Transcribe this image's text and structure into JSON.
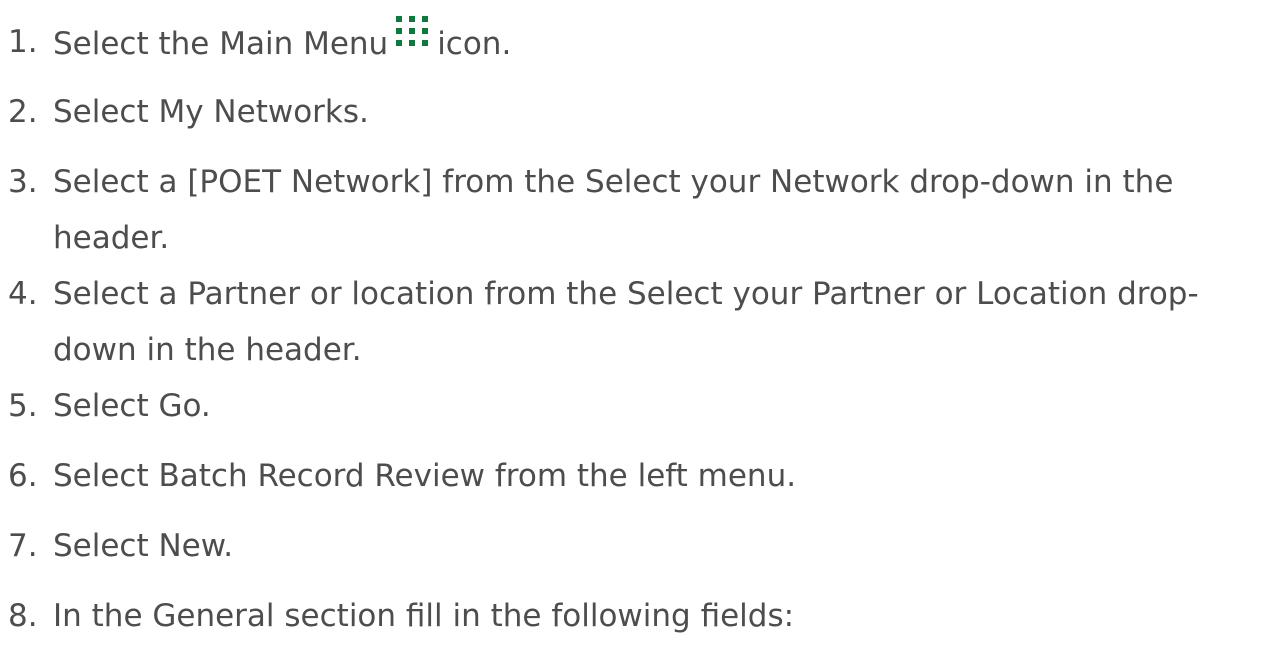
{
  "steps": [
    {
      "num": "1.",
      "before": "Select the Main Menu",
      "icon": "grid-menu-icon",
      "after": "icon."
    },
    {
      "num": "2.",
      "text": "Select My Networks."
    },
    {
      "num": "3.",
      "line1": "Select a [POET Network] from the Select your Network drop-down in the",
      "line2": "header."
    },
    {
      "num": "4.",
      "line1": "Select a Partner or location from the Select your Partner or Location drop-",
      "line2": "down in the header."
    },
    {
      "num": "5.",
      "text": "Select Go."
    },
    {
      "num": "6.",
      "text": "Select Batch Record Review from the left menu."
    },
    {
      "num": "7.",
      "text": "Select New."
    },
    {
      "num": "8.",
      "text": "In the General section fill in the following fields:"
    }
  ],
  "colors": {
    "text": "#4d4d4d",
    "icon": "#0d7a3d"
  }
}
